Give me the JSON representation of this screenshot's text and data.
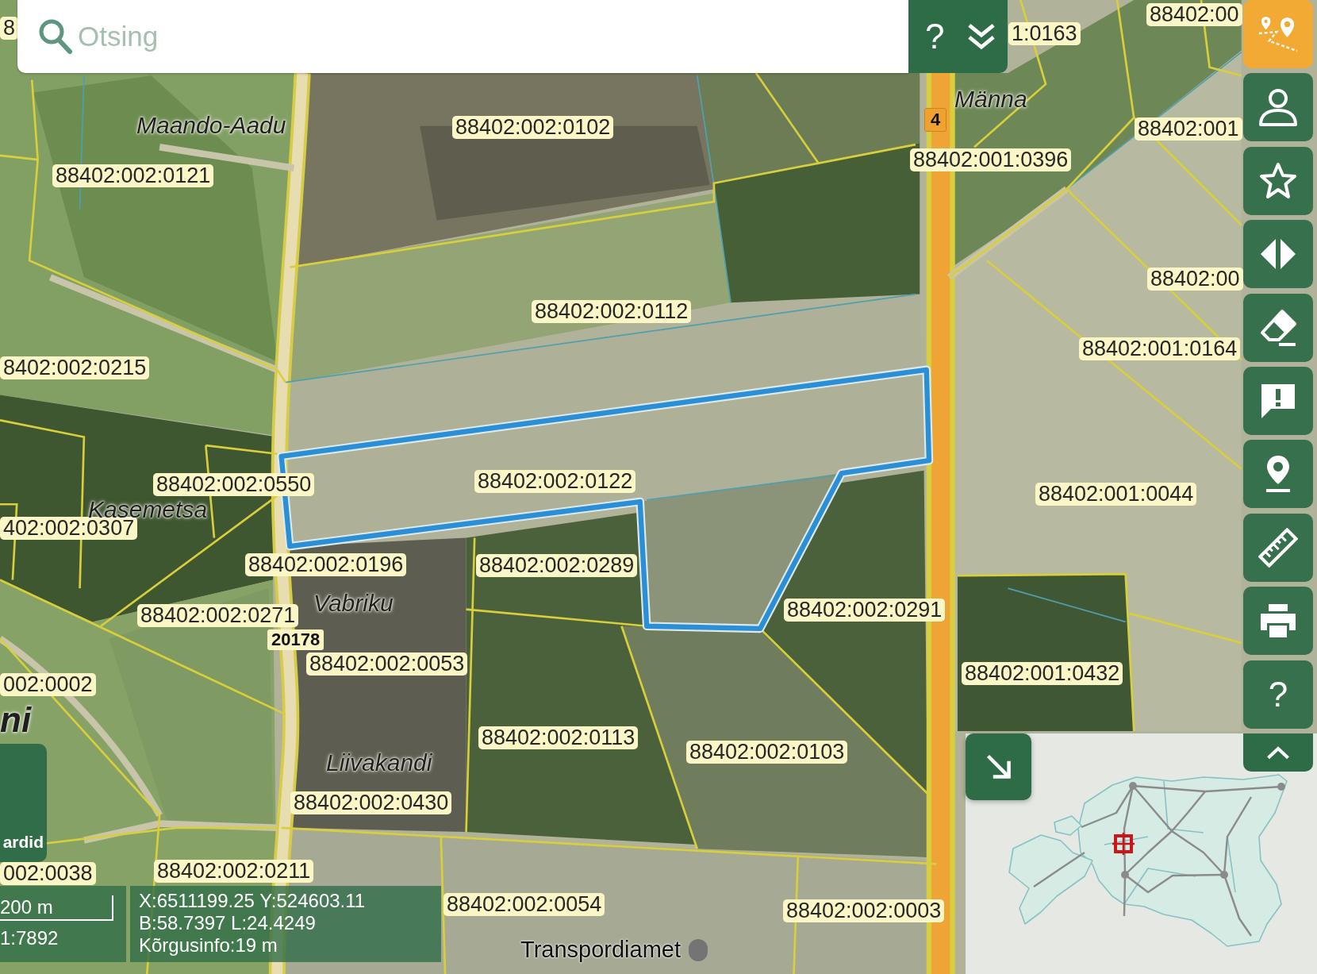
{
  "search": {
    "placeholder": "Otsing",
    "help_label": "?"
  },
  "toolbar": [
    {
      "selected": true
    },
    {
      "selected": false
    },
    {
      "selected": false
    },
    {
      "selected": false
    },
    {
      "selected": false
    },
    {
      "selected": false
    },
    {
      "selected": false
    },
    {
      "selected": false
    },
    {
      "selected": false
    },
    {
      "selected": false,
      "label": "?"
    }
  ],
  "map": {
    "parcel_labels": [
      "88402:00",
      "8",
      "1:0163",
      "88402:002:0102",
      "88402:001",
      "88402:001:0396",
      "88402:002:0121",
      "88402:00",
      "88402:002:0112",
      "88402:001:0164",
      "8402:002:0215",
      "88402:002:0122",
      "88402:002:0550",
      "88402:001:0044",
      "402:002:0307",
      "88402:002:0196",
      "88402:002:0289",
      "88402:002:0291",
      "88402:002:0271",
      "88402:002:0053",
      "88402:001:0432",
      "002:0002",
      "88402:002:0113",
      "88402:002:0103",
      "88402:002:0430",
      "002:0038",
      "88402:002:0211",
      "88402:002:0054",
      "88402:002:0003"
    ],
    "place_names": [
      {
        "kind": "farm",
        "label": "Maando-Aadu"
      },
      {
        "kind": "farm",
        "label": "Männa"
      },
      {
        "kind": "farm",
        "label": "Kasemetsa"
      },
      {
        "kind": "farm",
        "label": "Vabriku"
      },
      {
        "kind": "farm",
        "label": "Liivakandi"
      },
      {
        "kind": "village",
        "label": "ni"
      }
    ],
    "road_numbers": [
      {
        "kind": "highway",
        "label": "4"
      },
      {
        "kind": "local",
        "label": "20178"
      }
    ],
    "attribution": "Transpordiamet"
  },
  "base_maps_button": {
    "label": "ardid"
  },
  "scale": {
    "distance": "200 m",
    "ratio": "1:7892"
  },
  "coordinates": [
    "X:6511199.25 Y:524603.11",
    "B:58.7397 L:24.4249",
    "Kõrgusinfo:19 m"
  ],
  "overview_map": {
    "expanded": true
  }
}
